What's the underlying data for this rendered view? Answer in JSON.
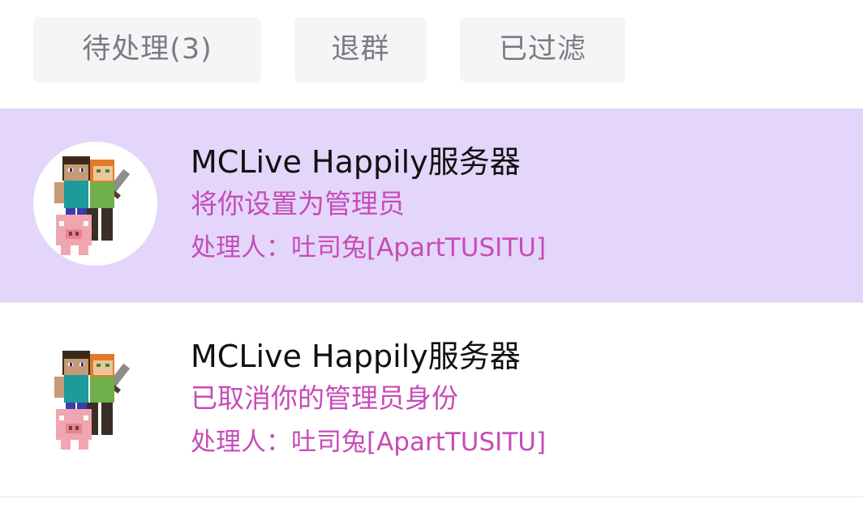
{
  "colors": {
    "highlight_row_bg": "#e3d6fa",
    "accent_text": "#c74bb8",
    "tab_bg": "#f4f5f7",
    "tab_text": "#7b7c80",
    "title_text": "#111111"
  },
  "tabs": [
    {
      "label": "待处理(3)"
    },
    {
      "label": "退群"
    },
    {
      "label": "已过滤"
    }
  ],
  "notifications": [
    {
      "title": "MCLive Happily服务器",
      "action": "将你设置为管理员",
      "handler": "处理人：吐司兔[ApartTUSITU]",
      "avatar_icon": "minecraft-characters-avatar",
      "highlighted": true
    },
    {
      "title": "MCLive Happily服务器",
      "action": "已取消你的管理员身份",
      "handler": "处理人：吐司兔[ApartTUSITU]",
      "avatar_icon": "minecraft-characters-avatar",
      "highlighted": false
    }
  ]
}
